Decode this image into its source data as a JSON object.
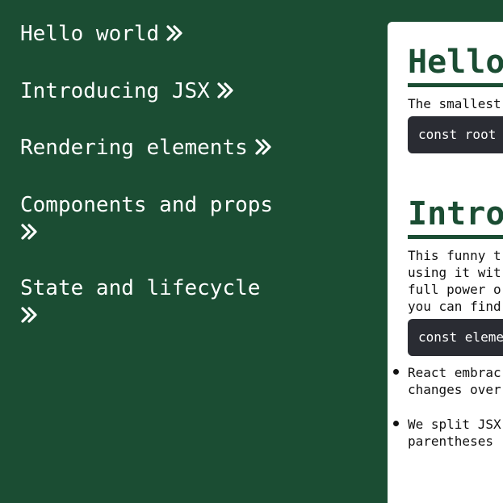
{
  "sidebar": {
    "items": [
      {
        "label": "Hello world",
        "icon": "chevron-double-right-icon"
      },
      {
        "label": "Introducing JSX",
        "icon": "chevron-double-right-icon"
      },
      {
        "label": "Rendering elements",
        "icon": "chevron-double-right-icon"
      },
      {
        "label": "Components and props",
        "icon": "chevron-double-right-icon"
      },
      {
        "label": "State and lifecycle",
        "icon": "chevron-double-right-icon"
      }
    ]
  },
  "main": {
    "sections": [
      {
        "title": "Hello",
        "paragraph_lines": [
          "The smallest"
        ],
        "code": "const root"
      },
      {
        "title": "Introd",
        "paragraph_lines": [
          "This funny t",
          "using it wit",
          "full power o",
          "you can find"
        ],
        "code": "const eleme",
        "bullets": [
          [
            "React embrac",
            "changes over"
          ],
          [
            "We split JSX",
            "parentheses"
          ]
        ]
      }
    ]
  },
  "colors": {
    "background": "#1b4d33",
    "panel": "#ffffff",
    "code_bg": "#2a2c33",
    "accent": "#1b4d33"
  }
}
